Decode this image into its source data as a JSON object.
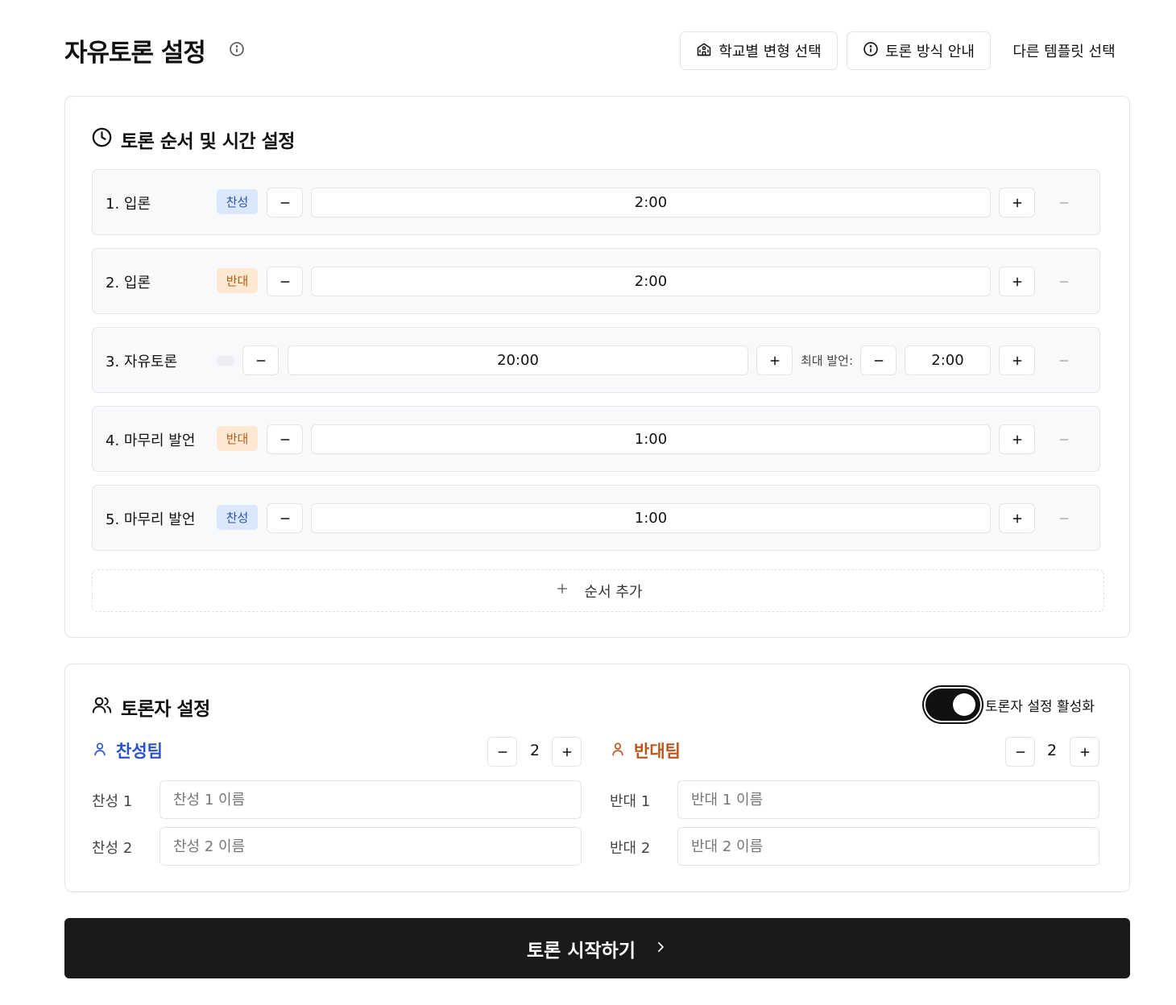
{
  "header": {
    "title": "자유토론 설정",
    "school_variant_label": "학교별 변형 선택",
    "guide_label": "토론 방식 안내",
    "template_label": "다른 템플릿 선택"
  },
  "order_section": {
    "title": "토론 순서 및 시간 설정",
    "add_label": "순서 추가",
    "max_speech_label": "최대 발언:",
    "items": [
      {
        "label": "1. 입론",
        "side": "찬성",
        "time": "2:00"
      },
      {
        "label": "2. 입론",
        "side": "반대",
        "time": "2:00"
      },
      {
        "label": "3. 자유토론",
        "side": "",
        "time": "20:00",
        "max_time": "2:00"
      },
      {
        "label": "4. 마무리 발언",
        "side": "반대",
        "time": "1:00"
      },
      {
        "label": "5. 마무리 발언",
        "side": "찬성",
        "time": "1:00"
      }
    ]
  },
  "debater_section": {
    "title": "토론자 설정",
    "toggle_label": "토론자 설정 활성화",
    "toggle_on": true,
    "pro_team": {
      "name": "찬성팀",
      "count": "2",
      "members": [
        {
          "label": "찬성 1",
          "placeholder": "찬성 1 이름"
        },
        {
          "label": "찬성 2",
          "placeholder": "찬성 2 이름"
        }
      ]
    },
    "con_team": {
      "name": "반대팀",
      "count": "2",
      "members": [
        {
          "label": "반대 1",
          "placeholder": "반대 1 이름"
        },
        {
          "label": "반대 2",
          "placeholder": "반대 2 이름"
        }
      ]
    }
  },
  "start_button": {
    "label": "토론 시작하기"
  },
  "colors": {
    "pro": "#2b53c8",
    "con": "#c0561f",
    "primary": "#1a1a1a"
  }
}
